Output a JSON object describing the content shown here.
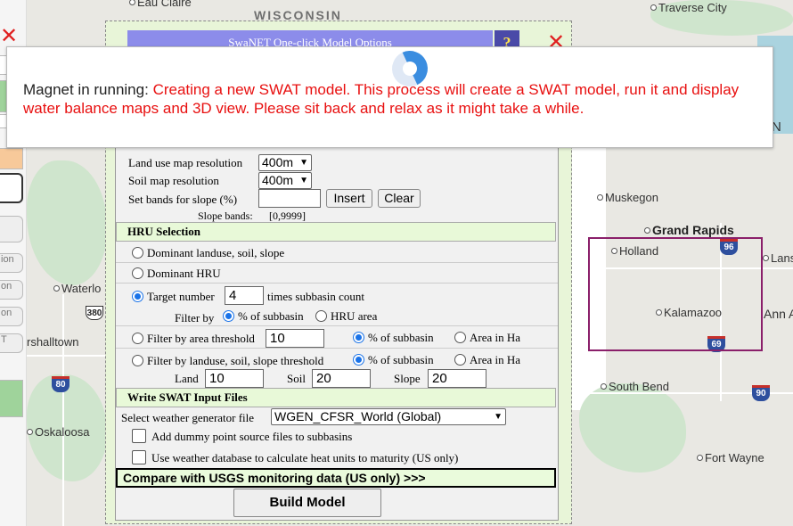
{
  "map": {
    "state_label": "WISCONSIN",
    "cities": {
      "eau_claire": "Eau Claire",
      "traverse_city": "Traverse City",
      "muskegon": "Muskegon",
      "grand_rapids": "Grand Rapids",
      "holland": "Holland",
      "lansing": "Lansin",
      "kalamazoo": "Kalamazoo",
      "ann_arbor": "Ann A",
      "waterloo": "Waterlo",
      "marshalltown": "rshalltown",
      "south_bend": "South Bend",
      "oskaloosa": "Oskaloosa",
      "fort_wayne": "Fort Wayne",
      "edge_n": "N"
    },
    "shields": {
      "i96": "96",
      "i69": "69",
      "i80": "80",
      "us380": "380",
      "i90": "90"
    },
    "region_color": "#8a1f6a"
  },
  "left_strip": {
    "items": [
      "ion",
      "on",
      "on",
      "T"
    ]
  },
  "dialog": {
    "title": "SwaNET One-click Model Options",
    "help_label": "?",
    "close_symbol": "✕",
    "landuse_resolution_label": "Land use map resolution",
    "landuse_resolution_value": "400m",
    "soil_resolution_label": "Soil map resolution",
    "soil_resolution_value": "400m",
    "slope_bands_label": "Set bands for slope (%)",
    "slope_bands_value": "",
    "insert_label": "Insert",
    "clear_label": "Clear",
    "slope_bands_display_label": "Slope bands:",
    "slope_bands_display_value": "[0,9999]",
    "hru_section": "HRU Selection",
    "hru_options": {
      "dominant_lss": "Dominant landuse, soil, slope",
      "dominant_hru": "Dominant HRU",
      "target_number": "Target number",
      "target_value": "4",
      "target_suffix": "times subbasin count",
      "filter_by_label": "Filter by",
      "pct_subbasin": "% of subbasin",
      "hru_area": "HRU area",
      "area_threshold": "Filter by area threshold",
      "area_threshold_value": "10",
      "pct_subbasin_2": "% of subbasin",
      "area_ha": "Area in Ha",
      "lss_threshold": "Filter by landuse, soil, slope threshold",
      "pct_subbasin_3": "% of subbasin",
      "area_ha_2": "Area in Ha",
      "land_label": "Land",
      "land_value": "10",
      "soil_label": "Soil",
      "soil_value": "20",
      "slope_label": "Slope",
      "slope_value": "20"
    },
    "write_section": "Write SWAT Input Files",
    "weather_label": "Select weather generator file",
    "weather_value": "WGEN_CFSR_World (Global)",
    "dummy_point_label": "Add dummy point source files to subbasins",
    "heat_units_label": "Use weather database to calculate heat units to maturity (US only)",
    "compare_label": "Compare with USGS monitoring data (US only) >>>",
    "build_label": "Build Model"
  },
  "message": {
    "prefix": "Magnet in running:",
    "status": "Creating a new SWAT model. This process will create a SWAT model, run it and display water balance maps and 3D view. Please sit back and relax as it might take a while."
  }
}
